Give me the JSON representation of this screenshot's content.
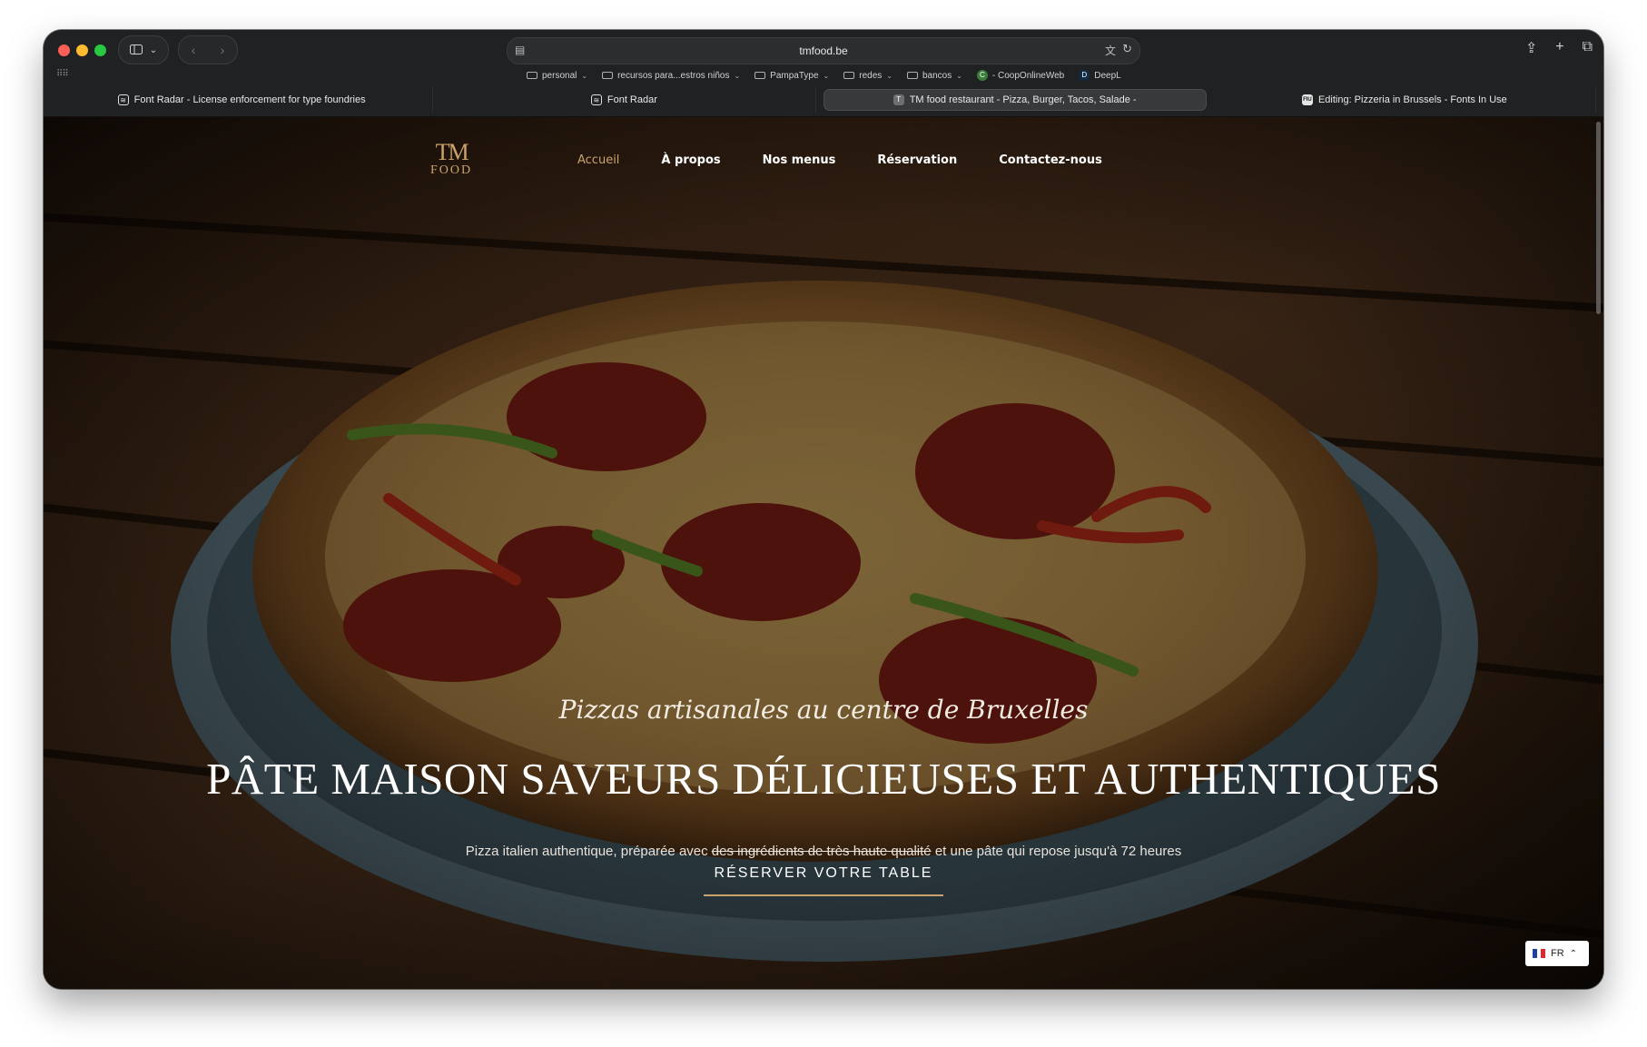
{
  "browser": {
    "url": "tmfood.be",
    "bookmarks": [
      {
        "label": "personal",
        "type": "folder",
        "has_menu": true
      },
      {
        "label": "recursos para...estros niños",
        "type": "folder",
        "has_menu": true
      },
      {
        "label": "PampaType",
        "type": "folder",
        "has_menu": true
      },
      {
        "label": "redes",
        "type": "folder",
        "has_menu": true
      },
      {
        "label": "bancos",
        "type": "folder",
        "has_menu": true
      },
      {
        "label": "- CoopOnlineWeb",
        "type": "site",
        "badge": "C",
        "badge_color": "#3b7d3b"
      },
      {
        "label": "DeepL",
        "type": "site",
        "badge": "D",
        "badge_color": "#0f2b46"
      }
    ],
    "tabs": [
      {
        "label": "Font Radar - License enforcement for type foundries",
        "favicon": "radar-icon",
        "active": false
      },
      {
        "label": "Font Radar",
        "favicon": "radar-icon",
        "active": false
      },
      {
        "label": "TM food restaurant - Pizza, Burger, Tacos, Salade -",
        "favicon": "T",
        "active": true
      },
      {
        "label": "Editing: Pizzeria in Brussels - Fonts In Use",
        "favicon": "FIU",
        "active": false
      }
    ]
  },
  "site": {
    "logo": {
      "top": "TM",
      "bottom": "FOOD"
    },
    "nav": [
      {
        "label": "Accueil",
        "active": true
      },
      {
        "label": "À propos",
        "active": false
      },
      {
        "label": "Nos menus",
        "active": false
      },
      {
        "label": "Réservation",
        "active": false
      },
      {
        "label": "Contactez-nous",
        "active": false
      }
    ],
    "hero": {
      "tagline": "Pizzas artisanales au centre de Bruxelles",
      "headline": "PÂTE MAISON SAVEURS DÉLICIEUSES ET AUTHENTIQUES",
      "desc_before": "Pizza italien authentique, préparée avec",
      "desc_struck": "des ingrédients de très haute qualité",
      "desc_after": "et une pâte qui repose jusqu'à 72 heures",
      "cta": "RÉSERVER VOTRE TABLE"
    },
    "language": {
      "code": "FR",
      "flag": "france-flag"
    }
  },
  "colors": {
    "accent_gold": "#c9a36b"
  }
}
